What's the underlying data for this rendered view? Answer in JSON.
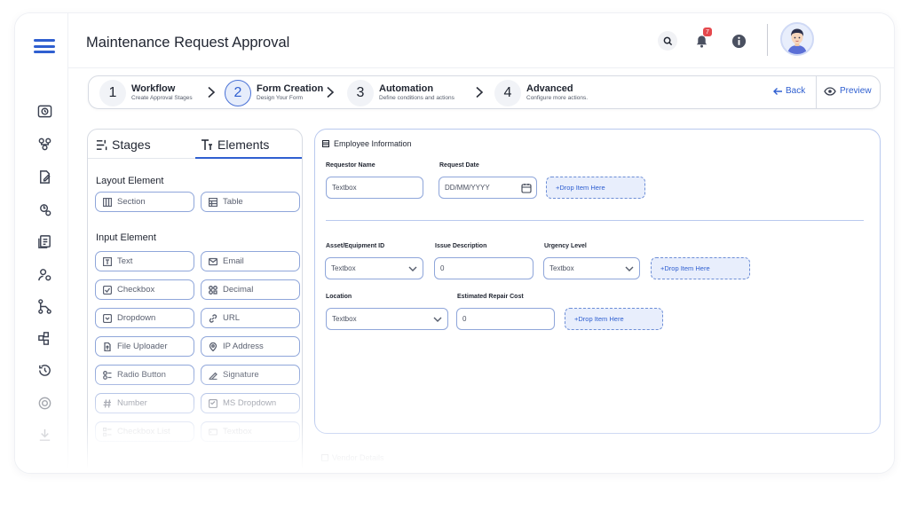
{
  "header": {
    "title": "Maintenance Request Approval",
    "notification_count": "7"
  },
  "stepper": {
    "steps": [
      {
        "num": "1",
        "title": "Workflow",
        "sub": "Create Approval Stages"
      },
      {
        "num": "2",
        "title": "Form Creation",
        "sub": "Design Your Form"
      },
      {
        "num": "3",
        "title": "Automation",
        "sub": "Define conditions and actions"
      },
      {
        "num": "4",
        "title": "Advanced",
        "sub": "Configure more actions."
      }
    ],
    "active_step": "2",
    "back_label": "Back",
    "preview_label": "Preview"
  },
  "left_panel": {
    "tabs": {
      "stages": "Stages",
      "elements": "Elements"
    },
    "layout_label": "Layout Element",
    "layout_items": [
      "Section",
      "Table"
    ],
    "input_label": "Input Element",
    "input_items": [
      "Text",
      "Email",
      "Checkbox",
      "Decimal",
      "Dropdown",
      "URL",
      "File Uploader",
      "IP Address",
      "Radio Button",
      "Signature",
      "Number",
      "MS Dropdown",
      "Checkbox List",
      "Textbox"
    ]
  },
  "form": {
    "section_title": "Employee Information",
    "row1": {
      "requestor_label": "Requestor Name",
      "requestor_placeholder": "Textbox",
      "date_label": "Request Date",
      "date_placeholder": "DD/MM/YYYY",
      "drop": "+Drop Item Here"
    },
    "row2": {
      "asset_label": "Asset/Equipment ID",
      "asset_value": "Textbox",
      "issue_label": "Issue Description",
      "issue_value": "0",
      "urgency_label": "Urgency Level",
      "urgency_value": "Textbox",
      "drop": "+Drop Item Here"
    },
    "row3": {
      "location_label": "Location",
      "location_value": "Textbox",
      "cost_label": "Estimated Repair Cost",
      "cost_value": "0",
      "drop": "+Drop Item Here"
    },
    "next_section": "Vendor Details"
  },
  "colors": {
    "accent": "#2f5fd0",
    "drop_bg": "#e8eefc",
    "badge": "#e5484d"
  }
}
